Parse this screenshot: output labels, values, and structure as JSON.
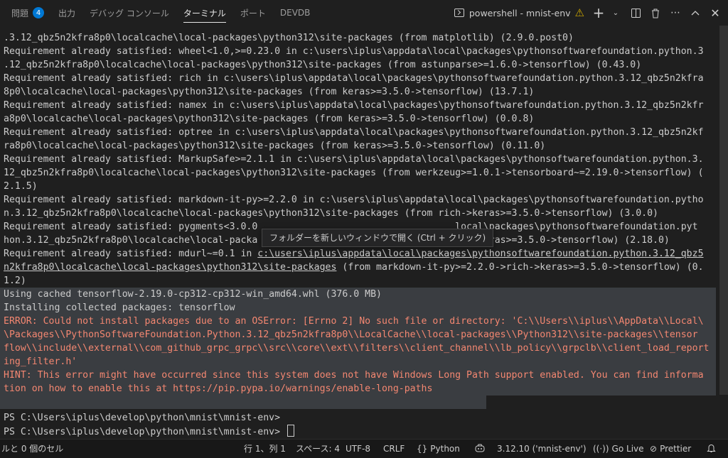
{
  "tabs": [
    {
      "label": "問題",
      "badge": "4"
    },
    {
      "label": "出力"
    },
    {
      "label": "デバッグ コンソール"
    },
    {
      "label": "ターミナル",
      "active": true
    },
    {
      "label": "ポート"
    },
    {
      "label": "DEVDB"
    }
  ],
  "terminal_name": "powershell - mnist-env",
  "terminal_lines": [
    {
      "text": ".3.12_qbz5n2kfra8p0\\localcache\\local-packages\\python312\\site-packages (from matplotlib) (2.9.0.post0)"
    },
    {
      "text": "Requirement already satisfied: wheel<1.0,>=0.23.0 in c:\\users\\iplus\\appdata\\local\\packages\\pythonsoftwarefoundation.python.3"
    },
    {
      "text": ".12_qbz5n2kfra8p0\\localcache\\local-packages\\python312\\site-packages (from astunparse>=1.6.0->tensorflow) (0.43.0)"
    },
    {
      "text": "Requirement already satisfied: rich in c:\\users\\iplus\\appdata\\local\\packages\\pythonsoftwarefoundation.python.3.12_qbz5n2kfra"
    },
    {
      "text": "8p0\\localcache\\local-packages\\python312\\site-packages (from keras>=3.5.0->tensorflow) (13.7.1)"
    },
    {
      "text": "Requirement already satisfied: namex in c:\\users\\iplus\\appdata\\local\\packages\\pythonsoftwarefoundation.python.3.12_qbz5n2kfr"
    },
    {
      "text": "a8p0\\localcache\\local-packages\\python312\\site-packages (from keras>=3.5.0->tensorflow) (0.0.8)"
    },
    {
      "text": "Requirement already satisfied: optree in c:\\users\\iplus\\appdata\\local\\packages\\pythonsoftwarefoundation.python.3.12_qbz5n2kf"
    },
    {
      "text": "ra8p0\\localcache\\local-packages\\python312\\site-packages (from keras>=3.5.0->tensorflow) (0.11.0)"
    },
    {
      "text": "Requirement already satisfied: MarkupSafe>=2.1.1 in c:\\users\\iplus\\appdata\\local\\packages\\pythonsoftwarefoundation.python.3."
    },
    {
      "text": "12_qbz5n2kfra8p0\\localcache\\local-packages\\python312\\site-packages (from werkzeug>=1.0.1->tensorboard~=2.19.0->tensorflow) ("
    },
    {
      "text": "2.1.5)"
    },
    {
      "text": "Requirement already satisfied: markdown-it-py>=2.2.0 in c:\\users\\iplus\\appdata\\local\\packages\\pythonsoftwarefoundation.pytho"
    },
    {
      "text": "n.3.12_qbz5n2kfra8p0\\localcache\\local-packages\\python312\\site-packages (from rich->keras>=3.5.0->tensorflow) (3.0.0)"
    },
    {
      "text": "Requirement already satisfied: pygments<3.0.0                                   local\\packages\\pythonsoftwarefoundation.pyt"
    },
    {
      "text": "hon.3.12_qbz5n2kfra8p0\\localcache\\local-packa                                  ich->keras>=3.5.0->tensorflow) (2.18.0)"
    },
    {
      "pre": "Requirement already satisfied: mdurl~=0.1 in ",
      "link": "c:\\users\\iplus\\appdata\\local\\packages\\pythonsoftwarefoundation.python.3.12_qbz5"
    },
    {
      "link": "n2kfra8p0\\localcache\\local-packages\\python312\\site-packages",
      "post": " (from markdown-it-py>=2.2.0->rich->keras>=3.5.0->tensorflow) (0."
    },
    {
      "text": "1.2)"
    },
    {
      "text": "Using cached tensorflow-2.19.0-cp312-cp312-win_amd64.whl (376.0 MB)"
    },
    {
      "text": "Installing collected packages: tensorflow"
    },
    {
      "text": "ERROR: Could not install packages due to an OSError: [Errno 2] No such file or directory: 'C:\\\\Users\\\\iplus\\\\AppData\\\\Local\\",
      "error": true
    },
    {
      "text": "\\Packages\\\\PythonSoftwareFoundation.Python.3.12_qbz5n2kfra8p0\\\\LocalCache\\\\local-packages\\\\Python312\\\\site-packages\\\\tensor",
      "error": true
    },
    {
      "text": "flow\\\\include\\\\external\\\\com_github_grpc_grpc\\\\src\\\\core\\\\ext\\\\filters\\\\client_channel\\\\lb_policy\\\\grpclb\\\\client_load_report",
      "error": true
    },
    {
      "text": "ing_filter.h'",
      "error": true
    },
    {
      "text": "HINT: This error might have occurred since this system does not have Windows Long Path support enabled. You can find informa",
      "error": true
    },
    {
      "text": "tion on how to enable this at https://pip.pypa.io/warnings/enable-long-paths",
      "error": true
    },
    {
      "text": ""
    },
    {
      "text": "PS C:\\Users\\iplus\\develop\\python\\mnist\\mnist-env>"
    },
    {
      "text": "PS C:\\Users\\iplus\\develop\\python\\mnist\\mnist-env> ",
      "cursor": true
    }
  ],
  "tooltip": "フォルダーを新しいウィンドウで開く (Ctrl + クリック)",
  "status": {
    "selection": "ルと 0 個のセル",
    "position": "行 1、列 1",
    "spaces": "スペース: 4",
    "encoding": "UTF-8",
    "eol": "CRLF",
    "language": "Python",
    "interpreter": "3.12.10 ('mnist-env')",
    "golive": "Go Live",
    "prettier": "Prettier"
  },
  "colors": {
    "error": "#f48771",
    "badge": "#0078d4",
    "selection": "#3a3d41",
    "warning": "#cca700"
  }
}
